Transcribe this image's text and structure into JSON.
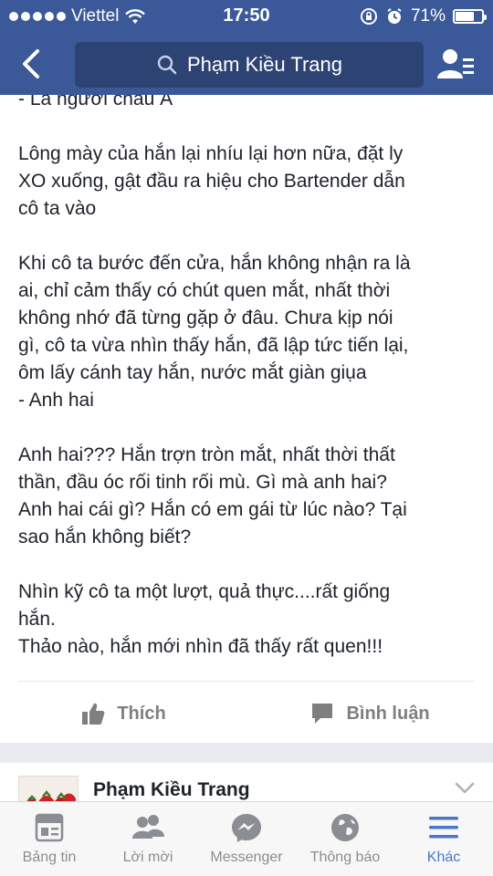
{
  "status_bar": {
    "carrier": "Viettel",
    "time": "17:50",
    "battery_percent": "71%",
    "battery_level": 0.71
  },
  "nav": {
    "search_text": "Phạm Kiều Trang"
  },
  "post": {
    "lines": [
      "- Là người châu Á",
      "",
      "Lông mày của hắn lại nhíu lại hơn nữa, đặt ly",
      "XO xuống, gật đầu ra hiệu cho Bartender dẫn",
      "cô ta vào",
      "",
      "Khi cô ta bước đến cửa, hắn không nhận ra là",
      "ai, chỉ cảm thấy có chút quen mắt, nhất thời",
      "không nhớ đã từng gặp ở đâu. Chưa kịp nói",
      "gì, cô ta vừa nhìn thấy hắn, đã lập tức tiến lại,",
      "ôm lấy cánh tay hắn, nước mắt giàn giụa",
      "- Anh hai",
      "",
      "Anh hai??? Hắn trợn tròn mắt, nhất thời thất",
      "thần, đầu óc rối tinh rối mù. Gì mà anh hai?",
      "Anh hai cái gì? Hắn có em gái từ lúc nào? Tại",
      "sao hắn không biết?",
      "",
      "Nhìn kỹ cô ta một lượt, quả thực....rất giống",
      "hắn.",
      "Thảo nào, hắn mới nhìn đã thấy rất quen!!!"
    ],
    "like_label": "Thích",
    "comment_label": "Bình luận"
  },
  "next_post": {
    "author": "Phạm Kiều Trang"
  },
  "tabbar": {
    "tabs": [
      {
        "label": "Bảng tin",
        "icon": "news-feed-icon"
      },
      {
        "label": "Lời mời",
        "icon": "friend-requests-icon"
      },
      {
        "label": "Messenger",
        "icon": "messenger-icon"
      },
      {
        "label": "Thông báo",
        "icon": "notifications-globe-icon"
      },
      {
        "label": "Khác",
        "icon": "menu-icon"
      }
    ],
    "active_index": 4
  },
  "colors": {
    "brand": "#3b5998",
    "active_tab": "#4a76c6",
    "inactive": "#8a8d91"
  }
}
